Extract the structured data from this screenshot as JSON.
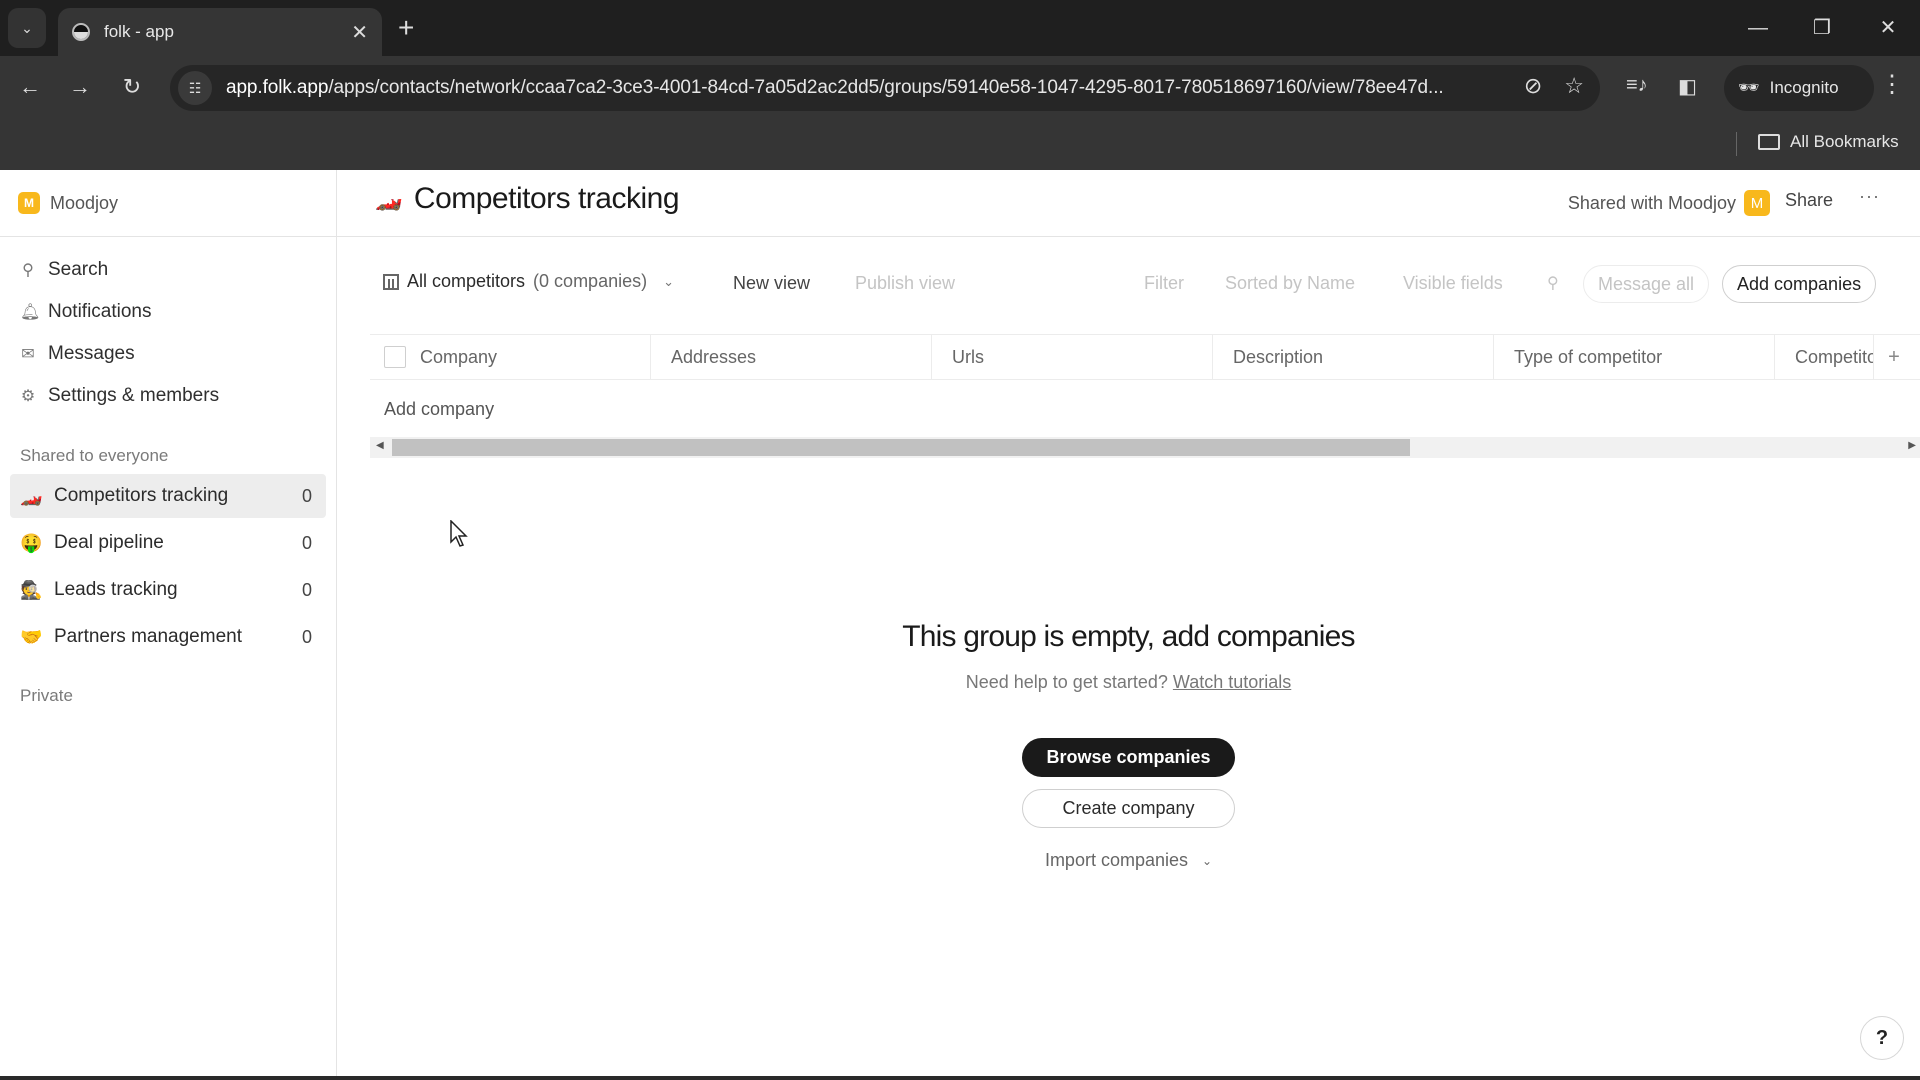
{
  "browser": {
    "tab_title": "folk - app",
    "url_host": "app.folk.app",
    "url_path": "/apps/contacts/network/ccaa7ca2-3ce3-4001-84cd-7a05d2ac2dd5/groups/59140e58-1047-4295-8017-780518697160/view/78ee47d...",
    "incognito_label": "Incognito",
    "bookmarks_label": "All Bookmarks",
    "icons": [
      "tab-search-icon",
      "close-icon",
      "new-tab-icon",
      "back-icon",
      "forward-icon",
      "reload-icon",
      "site-info-icon",
      "eye-off-icon",
      "star-icon",
      "media-icon",
      "side-panel-icon",
      "incognito-icon",
      "menu-icon",
      "folder-icon"
    ]
  },
  "sidebar": {
    "workspace": {
      "badge": "M",
      "name": "Moodjoy"
    },
    "nav": [
      {
        "label": "Search",
        "icon": "search-icon"
      },
      {
        "label": "Notifications",
        "icon": "bell-icon"
      },
      {
        "label": "Messages",
        "icon": "mail-icon"
      },
      {
        "label": "Settings & members",
        "icon": "gear-icon"
      }
    ],
    "shared_section": "Shared to everyone",
    "groups": [
      {
        "emoji": "🏎️",
        "label": "Competitors tracking",
        "count": "0",
        "active": true
      },
      {
        "emoji": "🤑",
        "label": "Deal pipeline",
        "count": "0"
      },
      {
        "emoji": "🕵️",
        "label": "Leads tracking",
        "count": "0"
      },
      {
        "emoji": "🤝",
        "label": "Partners management",
        "count": "0"
      }
    ],
    "private_section": "Private"
  },
  "header": {
    "emoji": "🏎️",
    "title": "Competitors tracking",
    "shared_with": "Shared with Moodjoy",
    "shared_badge": "M",
    "share_label": "Share",
    "more_label": "···"
  },
  "viewbar": {
    "view_name": "All competitors",
    "view_count": "(0 companies)",
    "new_view": "New view",
    "publish_view": "Publish view",
    "filter": "Filter",
    "sort": "Sorted by Name",
    "visible_fields": "Visible fields",
    "message_all": "Message all",
    "add_companies": "Add companies"
  },
  "table": {
    "columns": [
      "Company",
      "Addresses",
      "Urls",
      "Description",
      "Type of competitor",
      "Competito"
    ],
    "add_column": "+",
    "add_row_label": "Add company"
  },
  "empty_state": {
    "title": "This group is empty, add companies",
    "help_text": "Need help to get started?",
    "help_link": "Watch tutorials",
    "browse_button": "Browse companies",
    "create_button": "Create company",
    "import_label": "Import companies"
  },
  "help_button": "?"
}
